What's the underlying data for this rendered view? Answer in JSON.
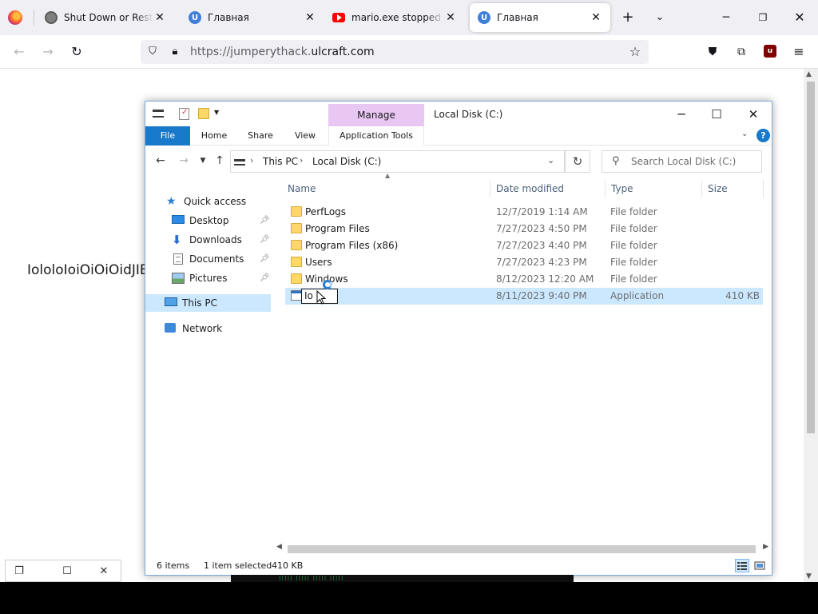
{
  "browser": {
    "tabs": [
      {
        "label": "Shut Down or Restart Windows"
      },
      {
        "label": "Главная"
      },
      {
        "label": "mario.exe stopped working"
      },
      {
        "label": "Главная"
      }
    ],
    "url_prefix": "https://jumperythack.",
    "url_host": "ulcraft.com"
  },
  "page": {
    "body_text": "IololoIoiOiOiOidJIE"
  },
  "explorer": {
    "window_title": "Local Disk (C:)",
    "contextual_tab": "Manage",
    "ribbon_tabs": [
      "File",
      "Home",
      "Share",
      "View",
      "Application Tools"
    ],
    "breadcrumb": [
      "This PC",
      "Local Disk (C:)"
    ],
    "search_placeholder": "Search Local Disk (C:)",
    "nav": {
      "quick_access": "Quick access",
      "desktop": "Desktop",
      "downloads": "Downloads",
      "documents": "Documents",
      "pictures": "Pictures",
      "this_pc": "This PC",
      "network": "Network"
    },
    "columns": {
      "name": "Name",
      "date": "Date modified",
      "type": "Type",
      "size": "Size"
    },
    "files": [
      {
        "name": "PerfLogs",
        "date": "12/7/2019 1:14 AM",
        "type": "File folder",
        "size": ""
      },
      {
        "name": "Program Files",
        "date": "7/27/2023 4:50 PM",
        "type": "File folder",
        "size": ""
      },
      {
        "name": "Program Files (x86)",
        "date": "7/27/2023 4:40 PM",
        "type": "File folder",
        "size": ""
      },
      {
        "name": "Users",
        "date": "7/27/2023 4:23 PM",
        "type": "File folder",
        "size": ""
      },
      {
        "name": "Windows",
        "date": "8/12/2023 12:20 AM",
        "type": "File folder",
        "size": ""
      },
      {
        "name": "Io",
        "date": "8/11/2023 9:40 PM",
        "type": "Application",
        "size": "410 KB"
      }
    ],
    "status": {
      "item_count": "6 items",
      "selection": "1 item selected",
      "selection_size": "410 KB"
    }
  },
  "colors": {
    "ribbon_file_blue": "#1979ca",
    "manage_purple": "#e8c7f3",
    "selection_blue": "#cce8ff"
  }
}
